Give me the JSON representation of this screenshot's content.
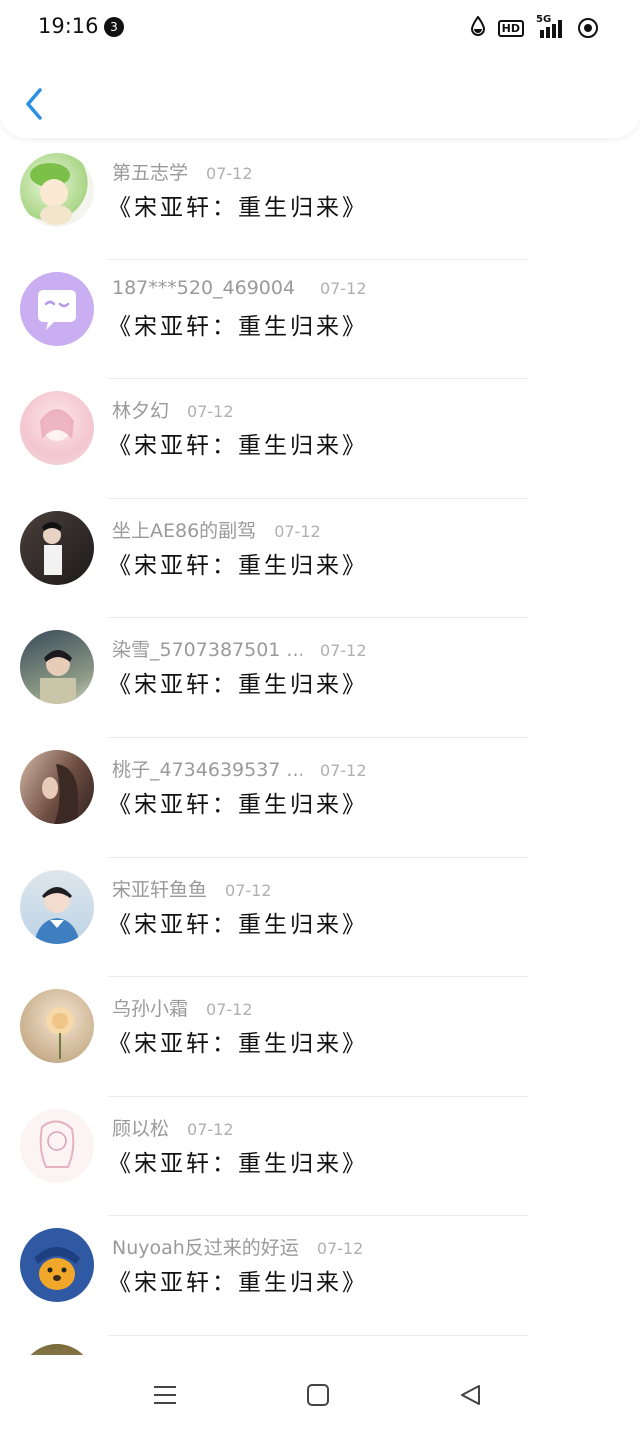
{
  "status_bar": {
    "time": "19:16",
    "notification_count": "3",
    "hd_label": "HD",
    "network_label": "5G"
  },
  "colors": {
    "accent": "#2b8fe6",
    "name_text": "#9a9a9a",
    "date_text": "#b0b0b0",
    "title_text": "#111111"
  },
  "header": {
    "back_icon": "chevron-left-icon"
  },
  "items": [
    {
      "name": "第五志学",
      "date": "07-12",
      "title": "《宋亚轩：重生归来》"
    },
    {
      "name": "187***520_469004 ...",
      "date": "07-12",
      "title": "《宋亚轩：重生归来》"
    },
    {
      "name": "林夕幻",
      "date": "07-12",
      "title": "《宋亚轩：重生归来》"
    },
    {
      "name": "坐上AE86的副驾",
      "date": "07-12",
      "title": "《宋亚轩：重生归来》"
    },
    {
      "name": "染雪_5707387501 ...",
      "date": "07-12",
      "title": "《宋亚轩：重生归来》"
    },
    {
      "name": "桃子_4734639537 ...",
      "date": "07-12",
      "title": "《宋亚轩：重生归来》"
    },
    {
      "name": "宋亚轩鱼鱼",
      "date": "07-12",
      "title": "《宋亚轩：重生归来》"
    },
    {
      "name": "乌孙小霜",
      "date": "07-12",
      "title": "《宋亚轩：重生归来》"
    },
    {
      "name": "顾以松",
      "date": "07-12",
      "title": "《宋亚轩：重生归来》"
    },
    {
      "name": "Nuyoah反过来的好运",
      "date": "07-12",
      "title": "《宋亚轩：重生归来》"
    }
  ],
  "nav_bar": {
    "menu_icon": "menu-icon",
    "home_icon": "home-square-icon",
    "back_icon": "back-triangle-icon"
  }
}
